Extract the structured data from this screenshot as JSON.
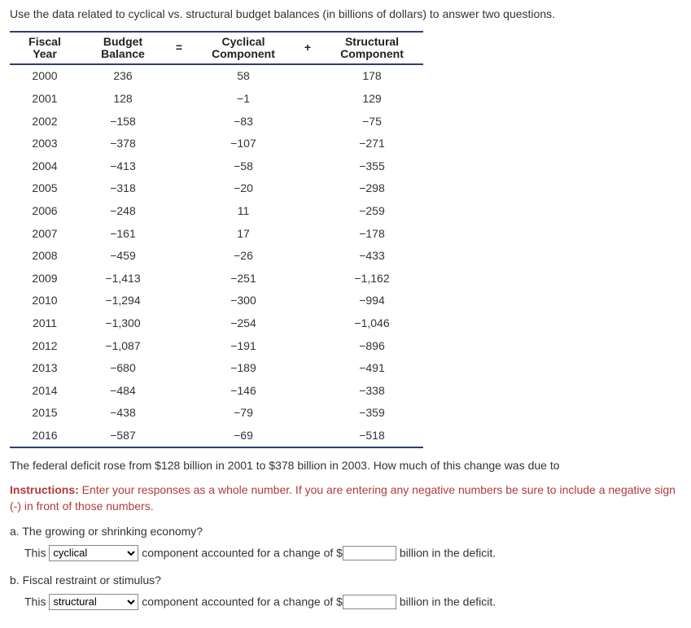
{
  "intro": "Use the data related to cyclical vs. structural budget balances (in billions of dollars) to answer two questions.",
  "table": {
    "headers": {
      "year_l1": "Fiscal",
      "year_l2": "Year",
      "bal_l1": "Budget",
      "bal_l2": "Balance",
      "eq": "=",
      "cyc_l1": "Cyclical",
      "cyc_l2": "Component",
      "plus": "+",
      "str_l1": "Structural",
      "str_l2": "Component"
    },
    "rows": [
      {
        "year": "2000",
        "balance": "236",
        "cyclical": "58",
        "structural": "178"
      },
      {
        "year": "2001",
        "balance": "128",
        "cyclical": "−1",
        "structural": "129"
      },
      {
        "year": "2002",
        "balance": "−158",
        "cyclical": "−83",
        "structural": "−75"
      },
      {
        "year": "2003",
        "balance": "−378",
        "cyclical": "−107",
        "structural": "−271"
      },
      {
        "year": "2004",
        "balance": "−413",
        "cyclical": "−58",
        "structural": "−355"
      },
      {
        "year": "2005",
        "balance": "−318",
        "cyclical": "−20",
        "structural": "−298"
      },
      {
        "year": "2006",
        "balance": "−248",
        "cyclical": "11",
        "structural": "−259"
      },
      {
        "year": "2007",
        "balance": "−161",
        "cyclical": "17",
        "structural": "−178"
      },
      {
        "year": "2008",
        "balance": "−459",
        "cyclical": "−26",
        "structural": "−433"
      },
      {
        "year": "2009",
        "balance": "−1,413",
        "cyclical": "−251",
        "structural": "−1,162"
      },
      {
        "year": "2010",
        "balance": "−1,294",
        "cyclical": "−300",
        "structural": "−994"
      },
      {
        "year": "2011",
        "balance": "−1,300",
        "cyclical": "−254",
        "structural": "−1,046"
      },
      {
        "year": "2012",
        "balance": "−1,087",
        "cyclical": "−191",
        "structural": "−896"
      },
      {
        "year": "2013",
        "balance": "−680",
        "cyclical": "−189",
        "structural": "−491"
      },
      {
        "year": "2014",
        "balance": "−484",
        "cyclical": "−146",
        "structural": "−338"
      },
      {
        "year": "2015",
        "balance": "−438",
        "cyclical": "−79",
        "structural": "−359"
      },
      {
        "year": "2016",
        "balance": "−587",
        "cyclical": "−69",
        "structural": "−518"
      }
    ]
  },
  "question_main": "The federal deficit rose from $128 billion in 2001 to $378 billion in 2003. How much of this change was due to",
  "instructions_label": "Instructions:",
  "instructions_text": " Enter your responses as a whole number. If you are entering any negative numbers be sure to include a negative sign (-) in front of those numbers.",
  "part_a": {
    "prompt": "a. The growing or shrinking economy?",
    "prefix": "This ",
    "select_value": "cyclical",
    "middle": " component accounted for a change of $",
    "suffix": " billion in the deficit.",
    "amount_value": ""
  },
  "part_b": {
    "prompt": "b. Fiscal restraint or stimulus?",
    "prefix": "This ",
    "select_value": "structural",
    "middle": " component accounted for a change of $",
    "suffix": " billion in the deficit.",
    "amount_value": ""
  },
  "select_options": [
    "cyclical",
    "structural"
  ]
}
